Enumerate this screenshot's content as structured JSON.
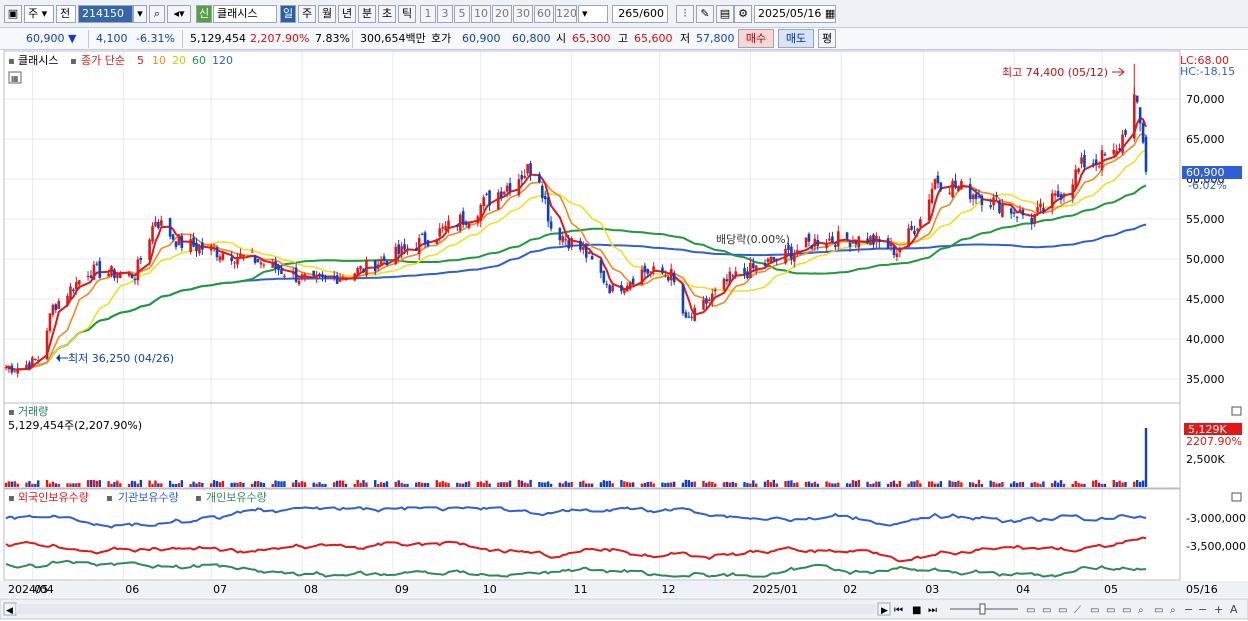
{
  "toolbar": {
    "market": "주",
    "prev": "전",
    "code": "214150",
    "stock_name": "클래시스",
    "credit_badge": "신",
    "periods": [
      "일",
      "주",
      "월",
      "년",
      "분",
      "초",
      "틱"
    ],
    "active_period": "일",
    "intervals": [
      "1",
      "3",
      "5",
      "10",
      "20",
      "30",
      "60",
      "120"
    ],
    "count": "265",
    "count_total": "/600",
    "date": "2025/05/16"
  },
  "quote": {
    "price": "60,900",
    "change": "4,100",
    "change_pct": "-6.31%",
    "volume": "5,129,454",
    "volume_ratio": "2,207.90%",
    "turnover": "7.83%",
    "amount": "300,654백만",
    "hoga_label": "호가",
    "ask": "60,900",
    "bid": "60,800",
    "open_label": "시",
    "open": "65,300",
    "high_label": "고",
    "high": "65,600",
    "low_label": "저",
    "low": "57,800",
    "buy_button": "매수",
    "sell_button": "매도",
    "eval_button": "평"
  },
  "price_pane": {
    "stock_name": "클래시스",
    "ma_title": "종가 단순",
    "ma_periods": [
      "5",
      "10",
      "20",
      "60",
      "120"
    ],
    "ma_colors": [
      "#e01818",
      "#f08a1c",
      "#f0e020",
      "#1e9a3a",
      "#2f5fd8"
    ],
    "lc": "LC:68.00",
    "hc": "HC:-18.15",
    "high_annotation": "최고 74,400 (05/12)",
    "low_annotation": "최저 36,250 (04/26)",
    "dividend_annotation": "배당락(0.00%)",
    "last_price_label": "60,900",
    "last_change_label": "-6.02%"
  },
  "volume_pane": {
    "title": "거래량",
    "info": "5,129,454주(2,207.90%)",
    "last_label": "5,129K",
    "last_pct": "2207.90%"
  },
  "holdings_pane": {
    "series": [
      "외국인보유수량",
      "기관보유수량",
      "개인보유수량"
    ],
    "colors": [
      "#e01818",
      "#2f5fd8",
      "#2e8b57"
    ]
  },
  "x_labels": [
    "2024/04",
    "05",
    "06",
    "07",
    "08",
    "09",
    "10",
    "11",
    "12",
    "2025/01",
    "02",
    "03",
    "04",
    "05",
    "05/16"
  ],
  "chart_data": [
    {
      "type": "candlestick",
      "title": "클래시스 종가 단순 5 10 20 60 120",
      "x": [
        "2024/04",
        "05",
        "06",
        "07",
        "08",
        "09",
        "10",
        "11",
        "12",
        "2025/01",
        "02",
        "03",
        "04",
        "05"
      ],
      "close_checkpoints": {
        "dates": [
          "2024/04/22",
          "2024/04/26",
          "2024/05/03",
          "2024/05/08",
          "2024/05/20",
          "2024/06/05",
          "2024/06/12",
          "2024/06/20",
          "2024/07/15",
          "2024/08/05",
          "2024/08/20",
          "2024/09/05",
          "2024/09/25",
          "2024/10/20",
          "2024/10/25",
          "2024/11/05",
          "2024/11/15",
          "2024/11/25",
          "2024/12/05",
          "2024/12/10",
          "2024/12/25",
          "2025/01/10",
          "2025/01/25",
          "2025/02/10",
          "2025/02/20",
          "2025/02/28",
          "2025/03/05",
          "2025/03/20",
          "2025/04/07",
          "2025/04/15",
          "2025/04/25",
          "2025/05/06",
          "2025/05/12",
          "2025/05/15",
          "2025/05/16"
        ],
        "values": [
          36500,
          36250,
          37500,
          44000,
          48500,
          48000,
          55000,
          52000,
          50000,
          47000,
          48500,
          51000,
          55000,
          62000,
          54000,
          51000,
          46000,
          48500,
          48000,
          42000,
          47500,
          50000,
          52500,
          52500,
          51000,
          55000,
          60000,
          58000,
          55000,
          57500,
          62000,
          63000,
          70000,
          65000,
          60900
        ]
      },
      "ylim": [
        32000,
        76000
      ],
      "yticks": [
        35000,
        40000,
        45000,
        50000,
        55000,
        60000,
        65000,
        70000
      ],
      "high": {
        "value": 74400,
        "date": "05/12"
      },
      "low": {
        "value": 36250,
        "date": "04/26"
      },
      "last": 60900,
      "last_change_pct": "-6.02%",
      "moving_averages": [
        "5",
        "10",
        "20",
        "60",
        "120"
      ]
    },
    {
      "type": "bar",
      "title": "거래량",
      "last_value": 5129454,
      "last_ratio": "2207.90%",
      "yticks": [
        "2,500K"
      ]
    },
    {
      "type": "line",
      "title": "외국인보유수량 / 기관보유수량 / 개인보유수량",
      "yticks": [
        "-3,000,000",
        "-3,500,000"
      ]
    }
  ]
}
